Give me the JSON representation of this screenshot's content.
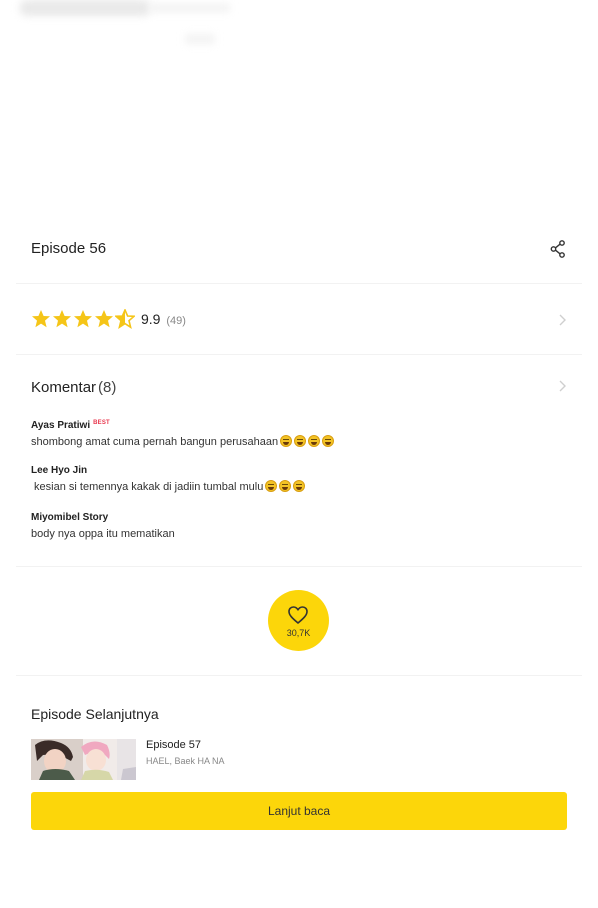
{
  "episode": {
    "title": "Episode 56"
  },
  "rating": {
    "score": "9.9",
    "count": "(49)",
    "stars": 4.5
  },
  "comments": {
    "title": "Komentar",
    "count": "(8)",
    "best_label": "BEST",
    "items": [
      {
        "author": "Ayas Pratiwi",
        "text": "shombong amat cuma pernah bangun perusahaan"
      },
      {
        "author": "Lee Hyo Jin",
        "text": " kesian si temennya kakak di jadiin tumbal mulu"
      },
      {
        "author": "Miyomibel Story",
        "text": "body nya oppa itu mematikan"
      }
    ]
  },
  "like": {
    "count": "30,7K"
  },
  "next": {
    "title": "Episode Selanjutnya",
    "episode": "Episode 57",
    "authors": "HAEL, Baek HA NA"
  },
  "continue_label": "Lanjut baca",
  "colors": {
    "accent": "#fcd60a",
    "star": "#f5c518",
    "best": "#e8374e"
  }
}
